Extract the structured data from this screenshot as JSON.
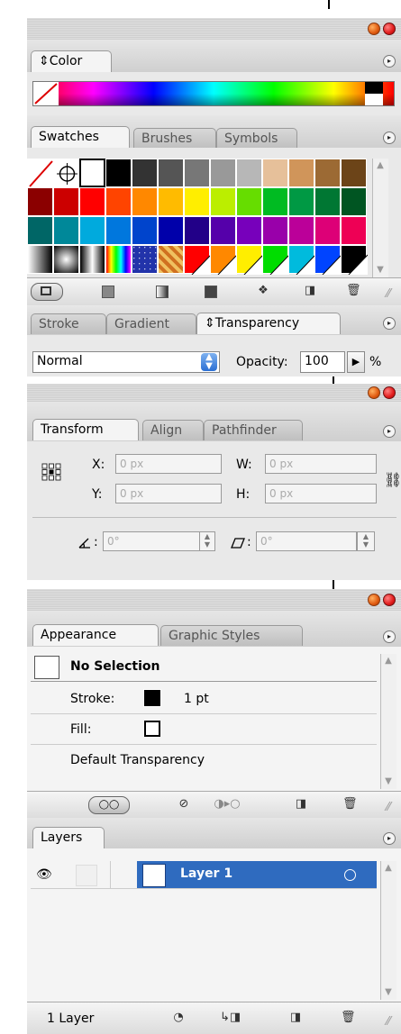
{
  "color_panel": {
    "tab": "Color",
    "tab_prefix": "⇕",
    "menu": "▸"
  },
  "swatches_panel": {
    "tabs": [
      "Swatches",
      "Brushes",
      "Symbols"
    ],
    "menu": "▸",
    "swatch_colors": [
      [
        "none",
        "#000000",
        "#ffffff",
        "#000000",
        "#333333",
        "#555555",
        "#777777",
        "#999999",
        "#b7b7b7",
        "#e6c09a",
        "#d0955a",
        "#9c6a34",
        "#6c4418"
      ],
      [
        "#8b0000",
        "#cc0000",
        "#ff0000",
        "#ff4400",
        "#ff8800",
        "#ffbb00",
        "#ffee00",
        "#bbee00",
        "#66dd00",
        "#00bb22",
        "#009944",
        "#007733",
        "#005522"
      ],
      [
        "#006666",
        "#008899",
        "#00aadd",
        "#0077dd",
        "#0044cc",
        "#0000aa",
        "#220088",
        "#5500aa",
        "#7700bb",
        "#9900aa",
        "#bb0099",
        "#dd0077",
        "#ee0055"
      ],
      [
        "grad1",
        "grad2",
        "grad3",
        "grad4",
        "pattern1",
        "pattern2",
        "#ff0000",
        "#ff8800",
        "#ffee00",
        "#00dd00",
        "#00bbdd",
        "#0044ff",
        "#000000"
      ]
    ]
  },
  "transparency_panel": {
    "tabs": [
      "Stroke",
      "Gradient",
      "Transparency"
    ],
    "tab_prefix": "⇕",
    "blend_mode": "Normal",
    "opacity_label": "Opacity:",
    "opacity_value": "100",
    "opacity_unit": "%"
  },
  "transform_panel": {
    "tabs": [
      "Transform",
      "Align",
      "Pathfinder"
    ],
    "x_label": "X:",
    "x_value": "0 px",
    "y_label": "Y:",
    "y_value": "0 px",
    "w_label": "W:",
    "w_value": "0 px",
    "h_label": "H:",
    "h_value": "0 px",
    "rotate_label": ":",
    "rotate_value": "0°",
    "shear_label": ":",
    "shear_value": "0°"
  },
  "appearance_panel": {
    "tabs": [
      "Appearance",
      "Graphic Styles"
    ],
    "selection": "No Selection",
    "stroke_label": "Stroke:",
    "stroke_weight": "1 pt",
    "fill_label": "Fill:",
    "transparency_label": "Default Transparency"
  },
  "layers_panel": {
    "tab": "Layers",
    "layer_name": "Layer 1",
    "footer_count": "1 Layer",
    "highlight": "#2f6bbf"
  }
}
